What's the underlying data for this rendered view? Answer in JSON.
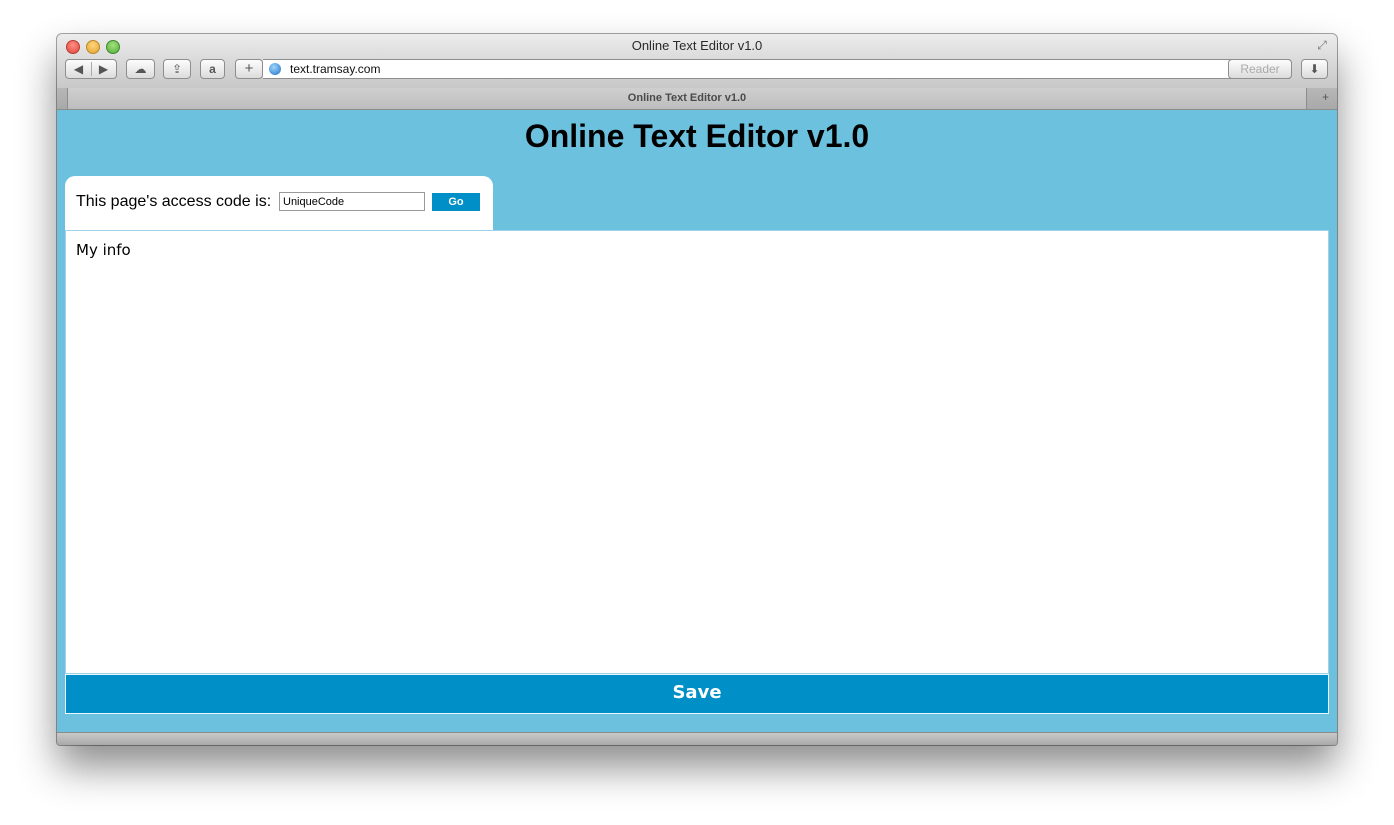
{
  "window": {
    "title": "Online Text Editor v1.0"
  },
  "toolbar": {
    "back_icon": "◀",
    "forward_icon": "▶",
    "icloud_icon": "☁",
    "share_icon": "⇪",
    "amazon_icon": "a",
    "add_icon": "+",
    "url": "text.tramsay.com",
    "reload_icon": "↻",
    "reader_label": "Reader",
    "downloads_icon": "⬇"
  },
  "tabs": [
    {
      "label": "Online Text Editor v1.0"
    }
  ],
  "page": {
    "heading": "Online Text Editor v1.0",
    "access_code_label": "This page's access code is:",
    "access_code_value": "UniqueCode",
    "go_label": "Go",
    "editor_text": "My info",
    "save_label": "Save"
  }
}
